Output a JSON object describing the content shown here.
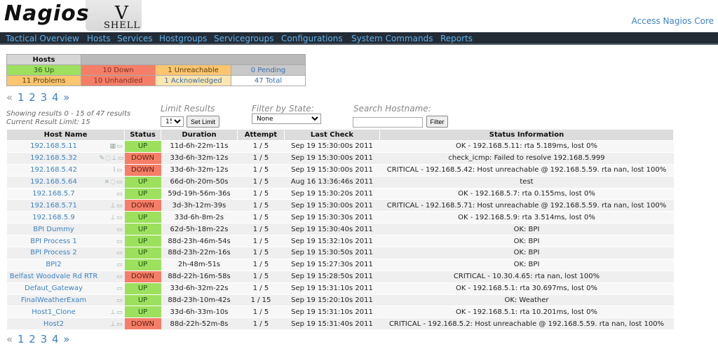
{
  "logo": {
    "word": "Nagios",
    "version": "V",
    "sub": "SHELL"
  },
  "access_link": "Access Nagios Core",
  "nav": [
    "Tactical Overview",
    "Hosts",
    "Services",
    "Hostgroups",
    "Servicegroups",
    "Configurations",
    "System Commands",
    "Reports"
  ],
  "summary": {
    "header": "Hosts",
    "row1": [
      "36 Up",
      "10 Down",
      "1 Unreachable",
      "0 Pending"
    ],
    "row2": [
      "11 Problems",
      "10 Unhandled",
      "1 Acknowledged",
      "47 Total"
    ]
  },
  "pager": {
    "prev": "«",
    "pages": [
      "1",
      "2",
      "3",
      "4"
    ],
    "next": "»"
  },
  "results": {
    "showing": "Showing results 0 - 15 of 47 results",
    "limit": "Current Result Limit: 15"
  },
  "filters": {
    "limit_label": "Limit Results",
    "limit_value": "15",
    "set_limit": "Set Limit",
    "state_label": "Filter by State:",
    "state_value": "None",
    "search_label": "Search Hostname:",
    "search_value": "",
    "filter_button": "Filter"
  },
  "table": {
    "headers": [
      "Host Name",
      "Status",
      "Duration",
      "Attempt",
      "Last Check",
      "Status Information"
    ],
    "rows": [
      {
        "host": "192.168.5.11",
        "icons": "▦▭",
        "status": "UP",
        "duration": "11d-6h-22m-11s",
        "attempt": "1 / 5",
        "last_check": "Sep 19 15:30:00s 2011",
        "info": "OK - 192.168.5.11: rta 5.189ms, lost 0%"
      },
      {
        "host": "192.168.5.32",
        "icons": "✎◌⊥▭",
        "status": "DOWN",
        "duration": "33d-6h-32m-12s",
        "attempt": "1 / 5",
        "last_check": "Sep 19 15:30:00s 2011",
        "info": "check_icmp: Failed to resolve 192.168.5.999"
      },
      {
        "host": "192.168.5.42",
        "icons": "⌇▭",
        "status": "DOWN",
        "duration": "33d-6h-32m-12s",
        "attempt": "1 / 5",
        "last_check": "Sep 19 15:30:00s 2011",
        "info": "CRITICAL - 192.168.5.42: Host unreachable @ 192.168.5.59. rta nan, lost 100%"
      },
      {
        "host": "192.168.5.64",
        "icons": "✕◌▭",
        "status": "UP",
        "duration": "66d-0h-20m-50s",
        "attempt": "1 / 5",
        "last_check": "Aug 16 13:36:46s 2011",
        "info": "test"
      },
      {
        "host": "192.168.5.7",
        "icons": "▭",
        "status": "UP",
        "duration": "59d-19h-56m-36s",
        "attempt": "1 / 5",
        "last_check": "Sep 19 15:30:20s 2011",
        "info": "OK - 192.168.5.7: rta 0.155ms, lost 0%"
      },
      {
        "host": "192.168.5.71",
        "icons": "⊥▭",
        "status": "DOWN",
        "duration": "3d-3h-12m-39s",
        "attempt": "1 / 5",
        "last_check": "Sep 19 15:30:00s 2011",
        "info": "CRITICAL - 192.168.5.71: Host unreachable @ 192.168.5.59. rta nan, lost 100%"
      },
      {
        "host": "192.168.5.9",
        "icons": "⊥▭",
        "status": "UP",
        "duration": "33d-6h-8m-2s",
        "attempt": "1 / 5",
        "last_check": "Sep 19 15:30:30s 2011",
        "info": "OK - 192.168.5.9: rta 3.514ms, lost 0%"
      },
      {
        "host": "BPI Dummy",
        "icons": "▭",
        "status": "UP",
        "duration": "62d-5h-18m-22s",
        "attempt": "1 / 5",
        "last_check": "Sep 19 15:30:40s 2011",
        "info": "OK: BPI"
      },
      {
        "host": "BPI Process 1",
        "icons": "▭",
        "status": "UP",
        "duration": "88d-23h-46m-54s",
        "attempt": "1 / 5",
        "last_check": "Sep 19 15:32:10s 2011",
        "info": "OK: BPI"
      },
      {
        "host": "BPI Process 2",
        "icons": "▭",
        "status": "UP",
        "duration": "88d-23h-22m-16s",
        "attempt": "1 / 5",
        "last_check": "Sep 19 15:30:50s 2011",
        "info": "OK: BPI"
      },
      {
        "host": "BPI2",
        "icons": "▭",
        "status": "UP",
        "duration": "2h-48m-51s",
        "attempt": "1 / 5",
        "last_check": "Sep 19 15:27:30s 2011",
        "info": "OK: BPI"
      },
      {
        "host": "Belfast Woodvale Rd RTR",
        "icons": "▭",
        "status": "DOWN",
        "duration": "88d-22h-16m-58s",
        "attempt": "1 / 5",
        "last_check": "Sep 19 15:28:50s 2011",
        "info": "CRITICAL - 10.30.4.65: rta nan, lost 100%"
      },
      {
        "host": "Defaut_Gateway",
        "icons": "▭",
        "status": "UP",
        "duration": "33d-6h-32m-22s",
        "attempt": "1 / 5",
        "last_check": "Sep 19 15:31:10s 2011",
        "info": "OK - 192.168.5.1: rta 30.697ms, lost 0%"
      },
      {
        "host": "FinalWeatherExam",
        "icons": "▭",
        "status": "UP",
        "duration": "88d-23h-10m-42s",
        "attempt": "1 / 15",
        "last_check": "Sep 19 15:20:10s 2011",
        "info": "OK: Weather"
      },
      {
        "host": "Host1_Clone",
        "icons": "⊥▭",
        "status": "UP",
        "duration": "33d-6h-33m-10s",
        "attempt": "1 / 5",
        "last_check": "Sep 19 15:31:10s 2011",
        "info": "OK - 192.168.5.1: rta 10.201ms, lost 0%"
      },
      {
        "host": "Host2",
        "icons": "⊥▭",
        "status": "DOWN",
        "duration": "88d-22h-52m-8s",
        "attempt": "1 / 5",
        "last_check": "Sep 19 15:31:40s 2011",
        "info": "CRITICAL - 192.168.5.2: Host unreachable @ 192.168.5.59. rta nan, lost 100%"
      }
    ]
  },
  "colors": {
    "up": "#9de05e",
    "down": "#f47e68",
    "unreachable": "#fbc570",
    "nav_bg": "#232c35",
    "link": "#3d82c4"
  }
}
